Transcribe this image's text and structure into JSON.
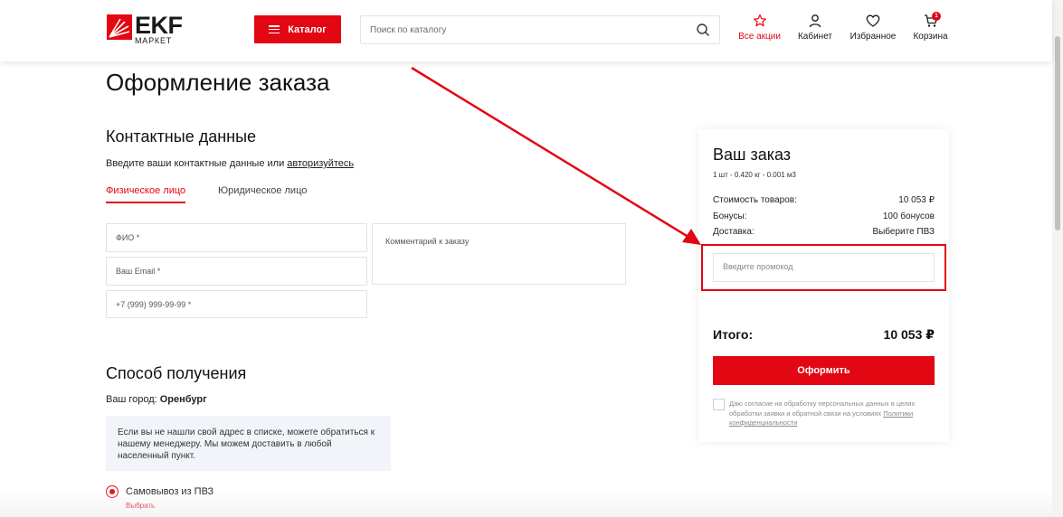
{
  "header": {
    "logo_text": "EKF",
    "logo_sub": "МАРКЕТ",
    "catalog_label": "Каталог",
    "search_placeholder": "Поиск по каталогу",
    "promos_label": "Все акции",
    "cabinet_label": "Кабинет",
    "favorites_label": "Избранное",
    "cart_label": "Корзина",
    "cart_count": "1"
  },
  "page": {
    "title": "Оформление заказа"
  },
  "contacts": {
    "title": "Контактные данные",
    "hint": "Введите ваши контактные данные или ",
    "login_link": "авторизуйтесь",
    "tabs": [
      "Физическое лицо",
      "Юридическое лицо"
    ],
    "fields": {
      "name_placeholder": "ФИО *",
      "email_placeholder": "Ваш Email *",
      "phone_placeholder": "+7 (999) 999-99-99 *",
      "comment_placeholder": "Комментарий к заказу"
    }
  },
  "delivery": {
    "title": "Способ получения",
    "city_label": "Ваш город: ",
    "city_value": "Оренбург",
    "info": "Если вы не нашли свой адрес в списке, можете обратиться к нашему менеджеру. Мы можем доставить в любой населенный пункт.",
    "option_label": "Самовывоз из ПВЗ",
    "option_link": "Выбрать"
  },
  "order": {
    "title": "Ваш заказ",
    "meta": "1 шт - 0.420 кг - 0.001 м3",
    "rows": [
      {
        "label": "Стоимость товаров:",
        "value": "10 053 ₽"
      },
      {
        "label": "Бонусы:",
        "value": "100 бонусов"
      },
      {
        "label": "Доставка:",
        "value": "Выберите ПВЗ"
      }
    ],
    "promo_placeholder": "Введите промокод",
    "total_label": "Итого:",
    "total_value": "10 053 ₽",
    "submit_label": "Оформить",
    "consent_text": "Даю согласие на обработку персональных данных в целях обработки заявки и обратной связи на условиях ",
    "consent_link": "Политики конфиденциальности"
  },
  "colors": {
    "brand_red": "#e30613",
    "info_bg": "#f1f5f9"
  }
}
